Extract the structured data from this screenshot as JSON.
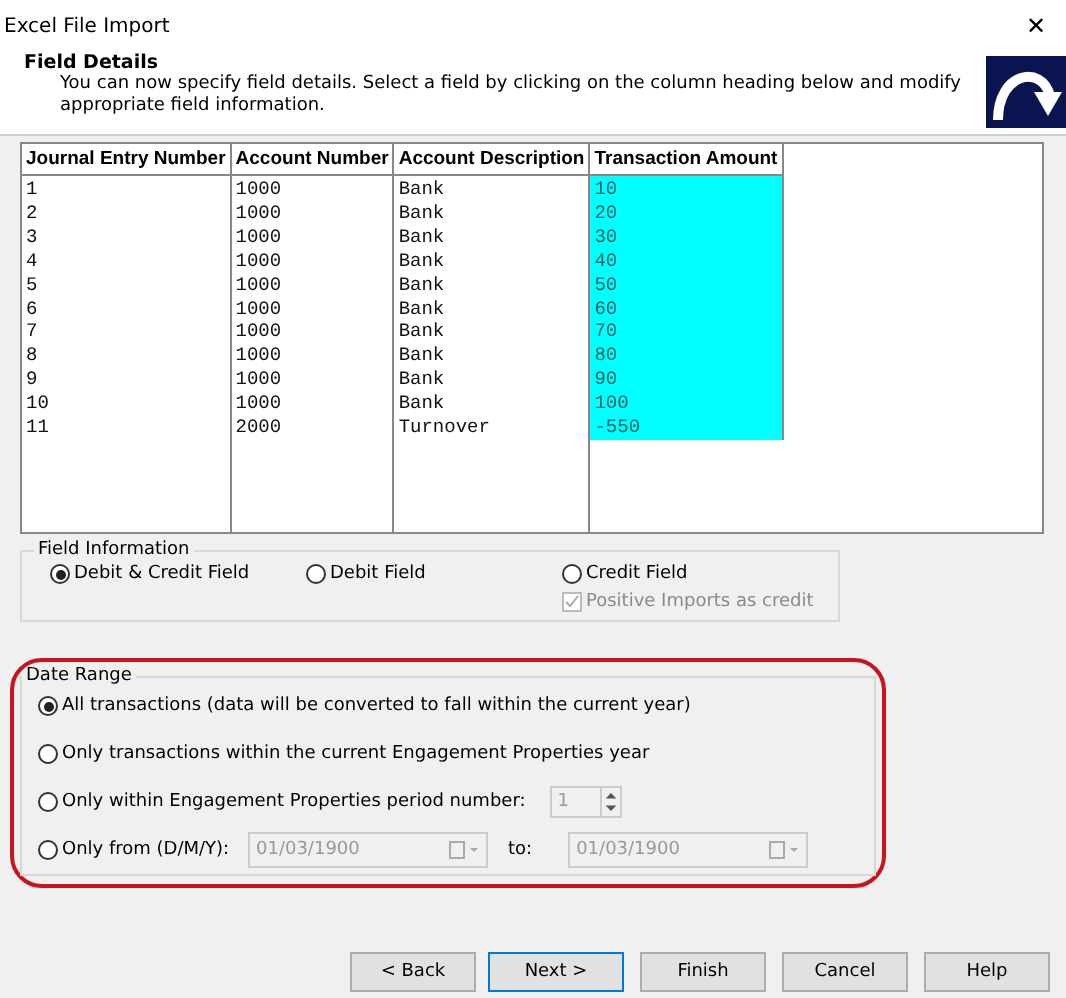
{
  "window": {
    "title": "Excel File Import",
    "close": "✕"
  },
  "header": {
    "title": "Field Details",
    "description": "You can now specify field details. Select a field by clicking on the column heading below and modify appropriate field information."
  },
  "table": {
    "columns": [
      {
        "label": "Journal Entry Number",
        "selected": false
      },
      {
        "label": "Account Number",
        "selected": false
      },
      {
        "label": "Account Description",
        "selected": false
      },
      {
        "label": "Transaction Amount",
        "selected": true
      }
    ],
    "rows": [
      [
        "1",
        "1000",
        "Bank",
        "10"
      ],
      [
        "2",
        "1000",
        "Bank",
        "20"
      ],
      [
        "3",
        "1000",
        "Bank",
        "30"
      ],
      [
        "4",
        "1000",
        "Bank",
        "40"
      ],
      [
        "5",
        "1000",
        "Bank",
        "50"
      ],
      [
        "6",
        "1000",
        "Bank",
        "60"
      ],
      [
        "7",
        "1000",
        "Bank",
        "70"
      ],
      [
        "8",
        "1000",
        "Bank",
        "80"
      ],
      [
        "9",
        "1000",
        "Bank",
        "90"
      ],
      [
        "10",
        "1000",
        "Bank",
        "100"
      ],
      [
        "11",
        "2000",
        "Turnover",
        "-550"
      ]
    ]
  },
  "field_information": {
    "title": "Field Information",
    "options": [
      {
        "label": "Debit & Credit Field",
        "selected": true
      },
      {
        "label": "Debit Field",
        "selected": false
      },
      {
        "label": "Credit Field",
        "selected": false
      }
    ],
    "positive_imports": {
      "label": "Positive Imports as credit",
      "checked": true,
      "disabled": true
    }
  },
  "date_range": {
    "title": "Date Range",
    "highlighted": true,
    "options": [
      {
        "label": "All transactions (data will be converted to fall within the current year)",
        "selected": true,
        "kind": "plain"
      },
      {
        "label": "Only transactions within the current Engagement Properties year",
        "selected": false,
        "kind": "plain"
      },
      {
        "label": "Only within Engagement Properties period number:",
        "selected": false,
        "kind": "period",
        "value": "1"
      },
      {
        "label": "Only from (D/M/Y):",
        "selected": false,
        "kind": "dates",
        "from": "01/03/1900",
        "to_label": "to:",
        "to": "01/03/1900"
      }
    ]
  },
  "buttons": [
    {
      "label": "< Back",
      "default": false
    },
    {
      "label": "Next >",
      "default": true
    },
    {
      "label": "Finish",
      "default": false
    },
    {
      "label": "Cancel",
      "default": false
    },
    {
      "label": "Help",
      "default": false
    }
  ]
}
